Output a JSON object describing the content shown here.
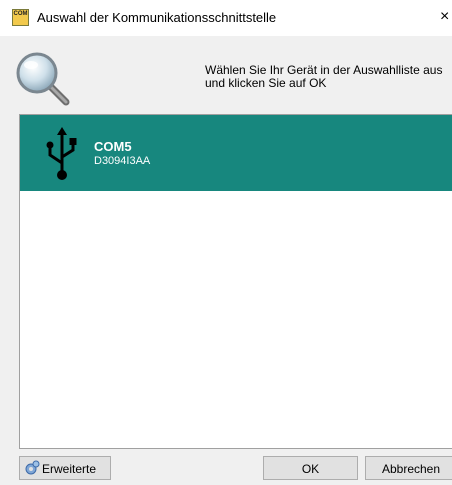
{
  "window": {
    "title": "Auswahl der Kommunikationsschnittstelle",
    "app_icon_label": "COM",
    "close_glyph": "×"
  },
  "header": {
    "instruction": "Wählen Sie Ihr Gerät in der Auswahlliste aus\nund klicken Sie auf OK"
  },
  "devices": [
    {
      "name": "COM5",
      "serial": "D3094I3AA",
      "icon": "usb-icon",
      "selected": true
    }
  ],
  "buttons": {
    "advanced": "Erweiterte",
    "ok": "OK",
    "cancel": "Abbrechen"
  },
  "colors": {
    "selection": "#17877e",
    "window_bg": "#f0f0f0"
  }
}
